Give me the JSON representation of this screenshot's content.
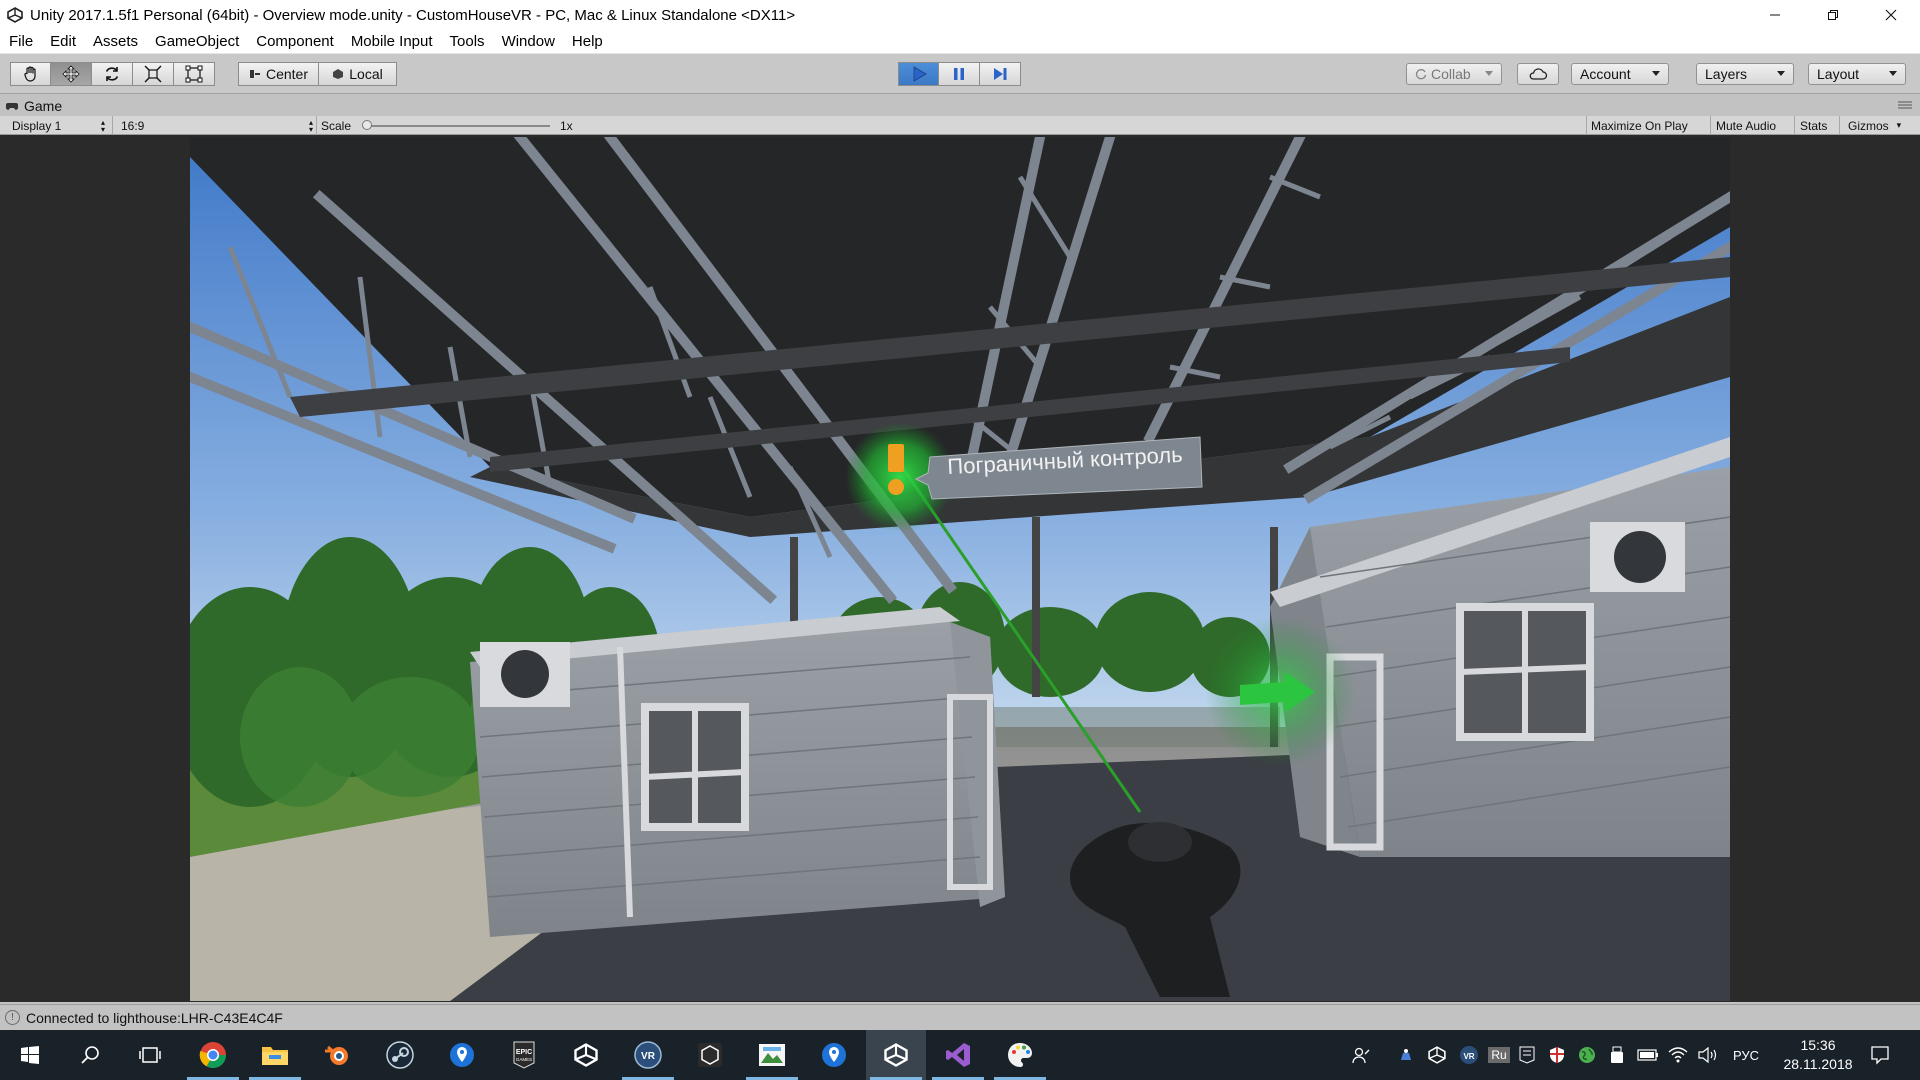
{
  "window": {
    "title": "Unity 2017.1.5f1 Personal (64bit) - Overview mode.unity - CustomHouseVR - PC, Mac & Linux Standalone <DX11>"
  },
  "menu": [
    "File",
    "Edit",
    "Assets",
    "GameObject",
    "Component",
    "Mobile Input",
    "Tools",
    "Window",
    "Help"
  ],
  "toolbar": {
    "pivot_label": "Center",
    "space_label": "Local",
    "collab_label": "Collab",
    "account_label": "Account",
    "layers_label": "Layers",
    "layout_label": "Layout"
  },
  "game_tab": {
    "label": "Game",
    "display": "Display 1",
    "aspect": "16:9",
    "scale_label": "Scale",
    "scale_value": "1x",
    "maximize_on_play": "Maximize On Play",
    "mute_audio": "Mute Audio",
    "stats": "Stats",
    "gizmos": "Gizmos"
  },
  "scene": {
    "waypoint_label": "Пограничный контроль"
  },
  "status": {
    "message": "Connected to lighthouse:LHR-C43E4C4F"
  },
  "taskbar": {
    "time": "15:36",
    "date": "28.11.2018",
    "language": "РУС",
    "tray_ru": "Ru"
  },
  "colors": {
    "play_active": "#3b79c4",
    "toolbar_bg": "#c8c8c8",
    "taskbar_bg": "#1a2229",
    "laser_green": "#2aa02a"
  }
}
